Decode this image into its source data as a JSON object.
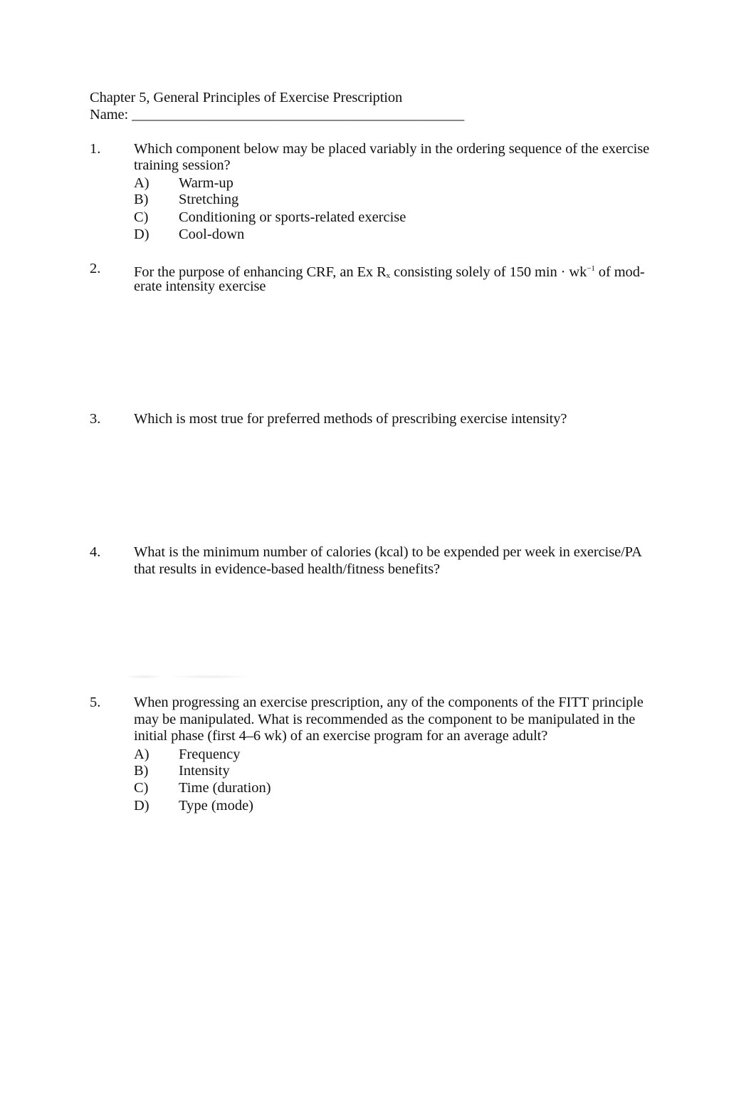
{
  "header": {
    "title": "Chapter 5, General Principles of Exercise Prescription",
    "name_label": "Name:",
    "name_blank": "______________________________________________"
  },
  "questions": [
    {
      "number": "1.",
      "lines": [
        "Which component below may be placed variably in the ordering sequence of the exercise",
        "training session?"
      ],
      "options": [
        {
          "letter": "A)",
          "text": "Warm-up"
        },
        {
          "letter": "B)",
          "text": "Stretching"
        },
        {
          "letter": "C)",
          "text": "Conditioning or sports-related exercise"
        },
        {
          "letter": "D)",
          "text": "Cool-down"
        }
      ]
    },
    {
      "number": "2.",
      "line1_a": "For the purpose of enhancing CRF, an Ex R",
      "line1_sub": "x",
      "line1_b": " consisting solely of 150 min · wk",
      "line1_sup": "−1",
      "line1_c": " of mod-",
      "line2": "erate intensity exercise"
    },
    {
      "number": "3.",
      "lines": [
        "Which is most true for preferred methods of prescribing exercise intensity?"
      ]
    },
    {
      "number": "4.",
      "lines": [
        "What is the minimum number of calories (kcal) to be expended per week in exercise/PA",
        "that results in evidence-based health/fitness benefits?"
      ]
    },
    {
      "number": "5.",
      "lines": [
        "When progressing an exercise prescription, any of the components of the FITT principle",
        "may be manipulated. What is recommended as the component to be manipulated in the",
        "initial phase (first 4–6 wk) of an exercise program for an average adult?"
      ],
      "options": [
        {
          "letter": "A)",
          "text": "Frequency"
        },
        {
          "letter": "B)",
          "text": "Intensity"
        },
        {
          "letter": "C)",
          "text": "Time (duration)"
        },
        {
          "letter": "D)",
          "text": "Type (mode)"
        }
      ]
    }
  ]
}
